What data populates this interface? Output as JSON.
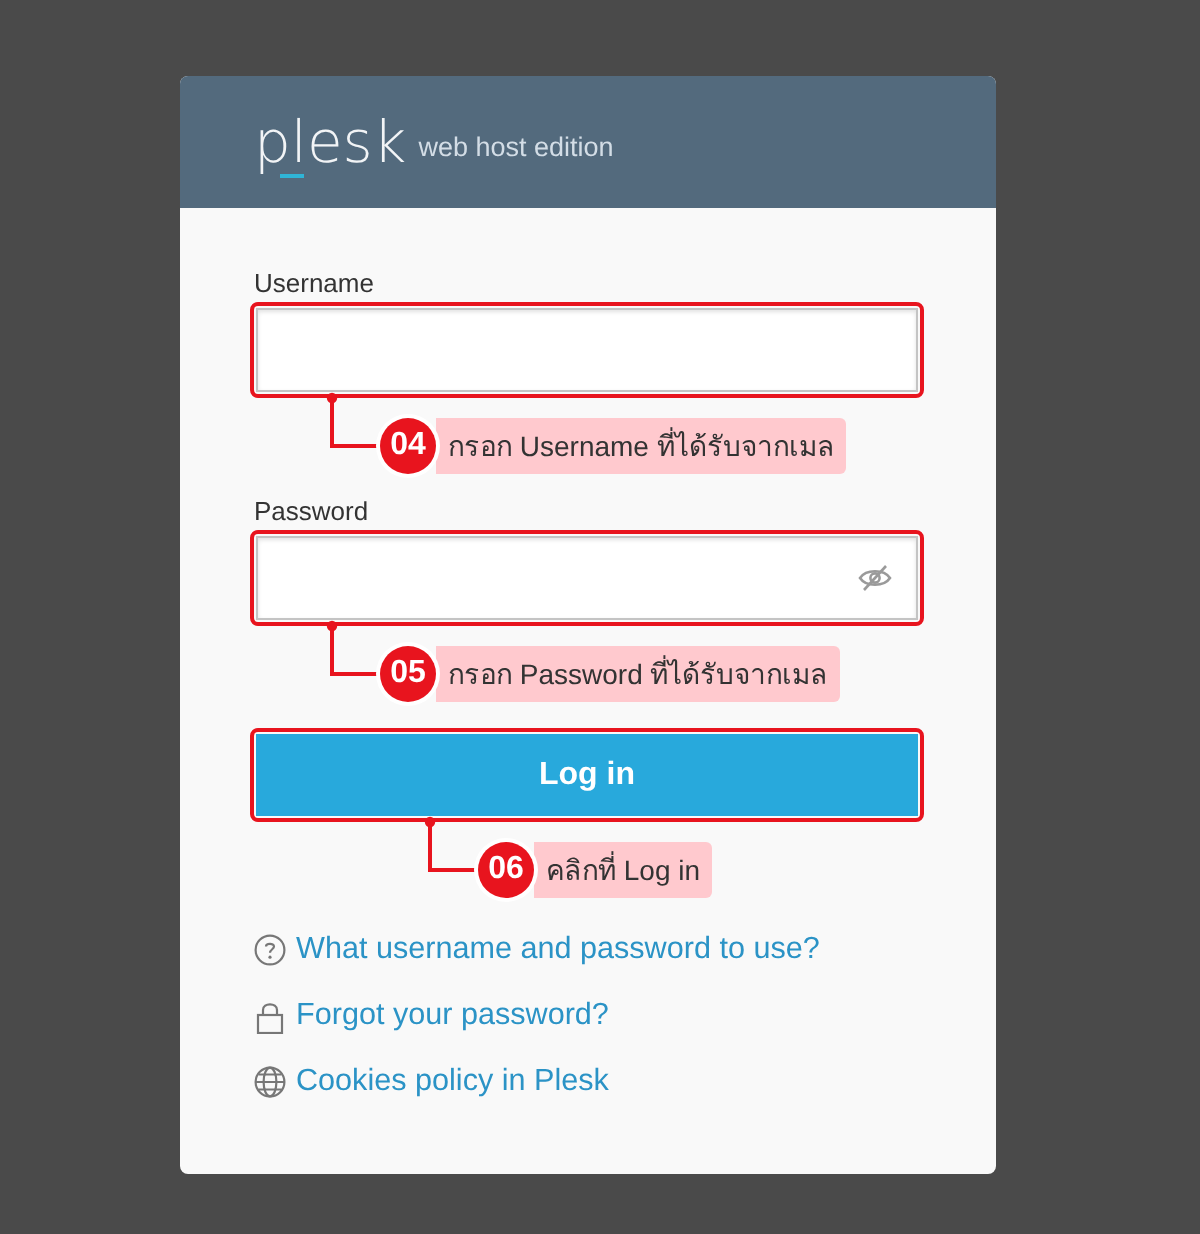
{
  "header": {
    "logo": "plesk",
    "subtitle": "web host edition"
  },
  "fields": [
    {
      "kind": "text",
      "label": "Username",
      "highlighted": true,
      "annotation": {
        "number": "04",
        "text": "กรอก Username ที่ได้รับจากเมล"
      }
    },
    {
      "kind": "password",
      "label": "Password",
      "highlighted": true,
      "annotation": {
        "number": "05",
        "text": "กรอก Password ที่ได้รับจากเมล"
      }
    }
  ],
  "login_button": {
    "label": "Log in",
    "highlighted": true,
    "annotation": {
      "number": "06",
      "text": "คลิกที่ Log in"
    }
  },
  "links": [
    {
      "kind": "help",
      "text": "What username and password to use?"
    },
    {
      "kind": "lock",
      "text": "Forgot your password?"
    },
    {
      "kind": "globe",
      "text": "Cookies policy in Plesk"
    }
  ]
}
